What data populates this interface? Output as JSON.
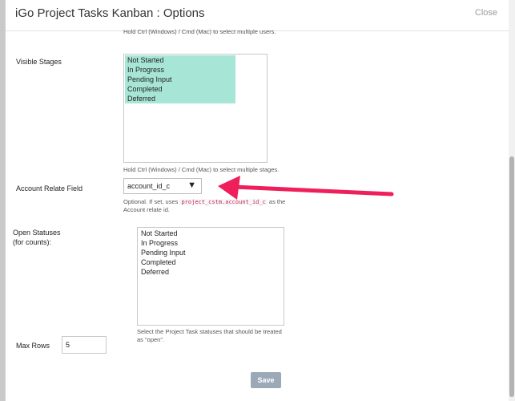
{
  "dialog": {
    "title": "iGo Project Tasks Kanban : Options",
    "close_label": "Close"
  },
  "users_hint": "Hold Ctrl (Windows) / Cmd (Mac) to select multiple users.",
  "visible_stages": {
    "label": "Visible Stages",
    "options": [
      "Not Started",
      "In Progress",
      "Pending Input",
      "Completed",
      "Deferred"
    ],
    "hint": "Hold Ctrl (Windows) / Cmd (Mac) to select multiple stages."
  },
  "account_relate": {
    "label": "Account Relate Field",
    "selected": "account_id_c",
    "hint_prefix": "Optional. If set, uses",
    "hint_code": "project_cstm.account_id_c",
    "hint_suffix": "as the",
    "hint_line2": "Account relate id."
  },
  "open_statuses": {
    "label_line1": "Open Statuses",
    "label_line2": "(for counts):",
    "options": [
      "Not Started",
      "In Progress",
      "Pending Input",
      "Completed",
      "Deferred"
    ],
    "hint_line1": "Select the Project Task statuses that should be treated",
    "hint_line2": "as \"open\"."
  },
  "max_rows": {
    "label": "Max Rows",
    "value": "5"
  },
  "save_label": "Save",
  "colors": {
    "selected_option": "#a7e6d6",
    "annotation_arrow": "#ee1f5a"
  }
}
